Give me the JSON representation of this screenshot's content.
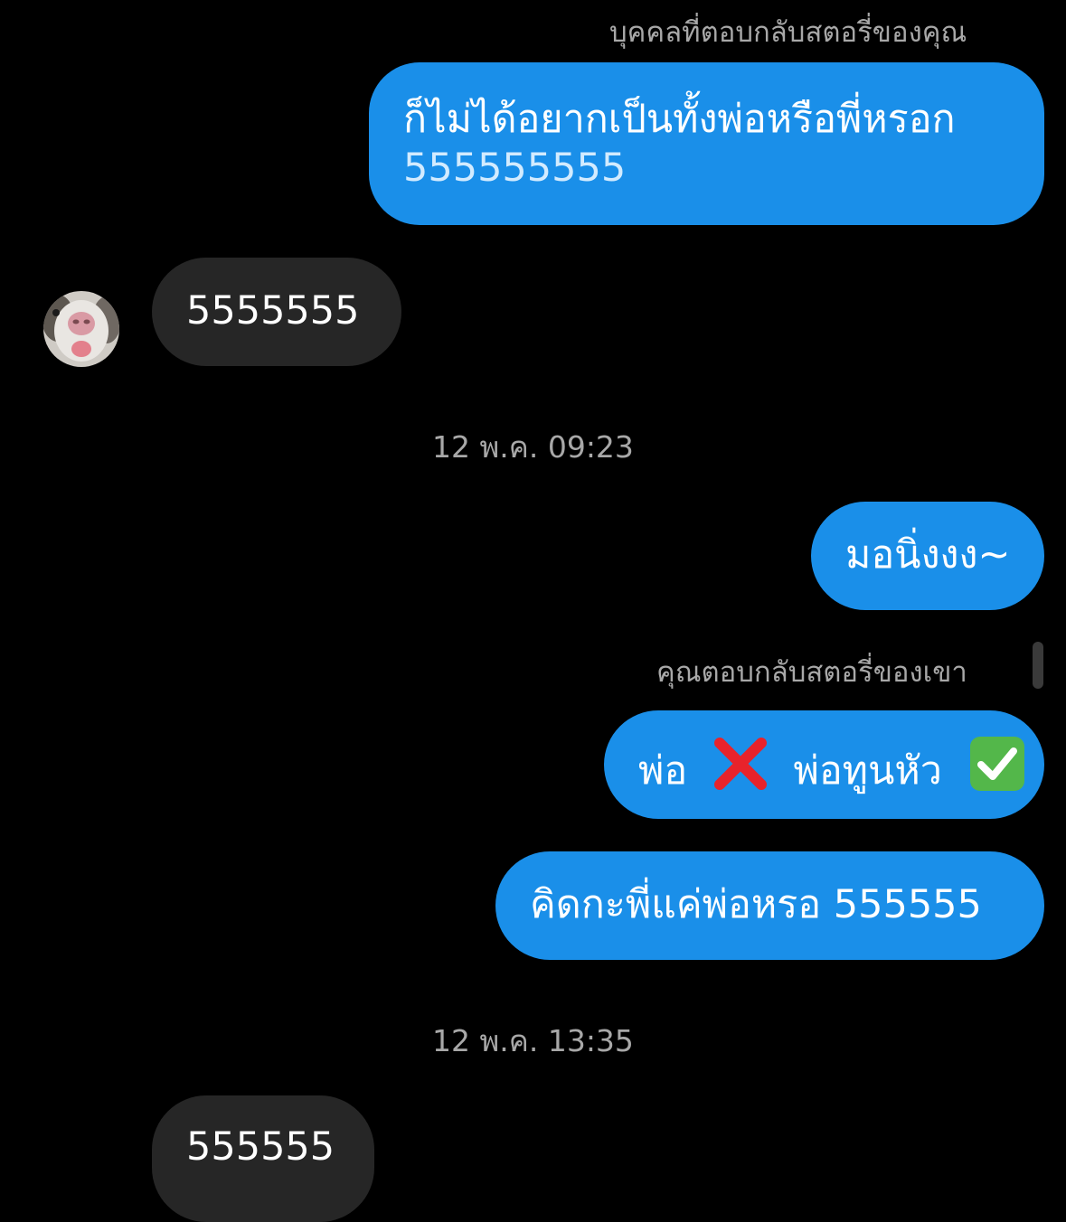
{
  "conversation": {
    "reply_caption_top": "บุคคลที่ตอบกลับสตอรี่ของคุณ",
    "reply_caption_mid": "คุณตอบกลับสตอรี่ของเขา",
    "timestamps": [
      "12 พ.ค. 09:23",
      "12 พ.ค. 13:35"
    ],
    "messages": [
      {
        "sender": "me",
        "lines": [
          "ก็ไม่ได้อยากเป็นทั้งพ่อหรือพี่หรอก",
          "555555555"
        ]
      },
      {
        "sender": "them",
        "text": "5555555"
      },
      {
        "sender": "me",
        "text": "มอนิ่งงง~"
      },
      {
        "sender": "me",
        "part1": "พ่อ",
        "part2": "พ่อทูนหัว",
        "icons": [
          "cross-mark-icon",
          "check-mark-button-icon"
        ]
      },
      {
        "sender": "me",
        "text": "คิดกะพี่แค่พ่อหรอ 555555"
      },
      {
        "sender": "them",
        "text": "555555"
      }
    ]
  },
  "colors": {
    "background": "#000000",
    "outgoing_bubble": "#1a8fe9",
    "incoming_bubble": "#262626",
    "meta_text": "#a8a8a8",
    "cross_red": "#e8232b",
    "check_green": "#53b74a"
  }
}
